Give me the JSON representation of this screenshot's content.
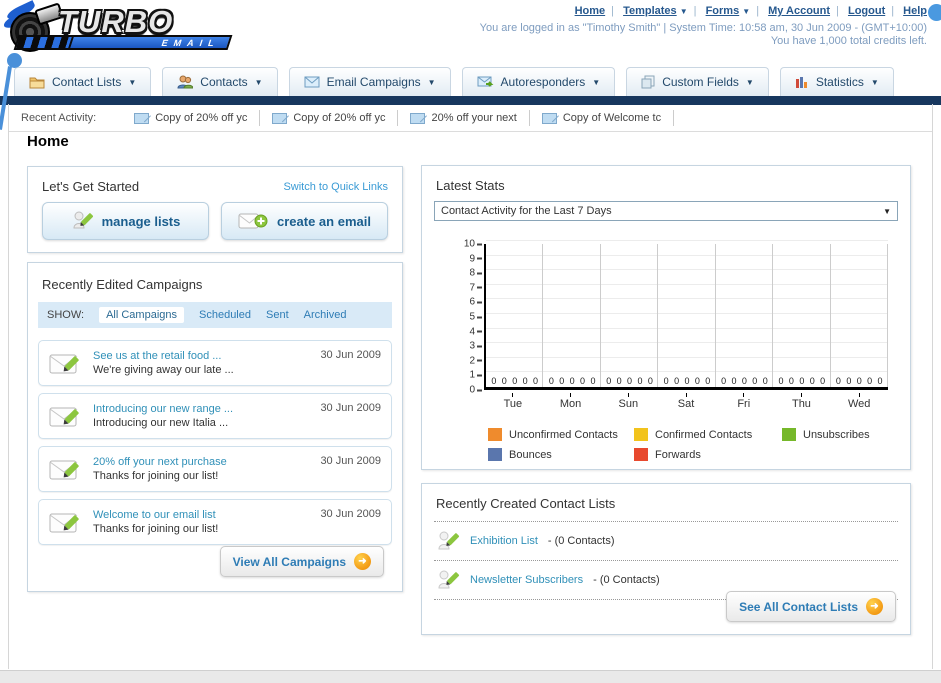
{
  "header": {
    "logo_title": "TURBO",
    "logo_subtitle": "EMAIL",
    "nav_links": [
      {
        "label": "Home",
        "dropdown": false
      },
      {
        "label": "Templates",
        "dropdown": true
      },
      {
        "label": "Forms",
        "dropdown": true
      },
      {
        "label": "My Account",
        "dropdown": false
      },
      {
        "label": "Logout",
        "dropdown": false
      },
      {
        "label": "Help",
        "dropdown": false
      }
    ],
    "login_info": "You are logged in as \"Timothy Smith\" | System Time: 10:58 am, 30 Jun 2009 - (GMT+10:00)",
    "credits_info": "You have 1,000 total credits left."
  },
  "tabs": [
    {
      "label": "Contact Lists",
      "icon": "folder-icon"
    },
    {
      "label": "Contacts",
      "icon": "contacts-icon"
    },
    {
      "label": "Email Campaigns",
      "icon": "envelope-icon"
    },
    {
      "label": "Autoresponders",
      "icon": "autoresponder-icon"
    },
    {
      "label": "Custom Fields",
      "icon": "pages-icon"
    },
    {
      "label": "Statistics",
      "icon": "bar-chart-icon"
    }
  ],
  "recent_activity": {
    "label": "Recent Activity:",
    "items": [
      "Copy of 20% off yc",
      "Copy of 20% off yc",
      "20% off your next ",
      "Copy of Welcome tc"
    ]
  },
  "page_title": "Home",
  "get_started": {
    "title": "Let's Get Started",
    "switch_link": "Switch to Quick Links",
    "manage_lists_label": "manage lists",
    "create_email_label": "create an email"
  },
  "campaigns": {
    "title": "Recently Edited Campaigns",
    "filter_label": "SHOW:",
    "filters": [
      "All Campaigns",
      "Scheduled",
      "Sent",
      "Archived"
    ],
    "active_filter": "All Campaigns",
    "items": [
      {
        "title": "See us at the retail food ...",
        "subtitle": "We're giving away our late ...",
        "date": "30 Jun 2009"
      },
      {
        "title": "Introducing our new range ...",
        "subtitle": "Introducing our new Italia ...",
        "date": "30 Jun 2009"
      },
      {
        "title": "20% off your next purchase",
        "subtitle": "Thanks for joining our list!",
        "date": "30 Jun 2009"
      },
      {
        "title": "Welcome to our email list",
        "subtitle": "Thanks for joining our list!",
        "date": "30 Jun 2009"
      }
    ],
    "view_all_label": "View All Campaigns"
  },
  "stats": {
    "title": "Latest Stats",
    "selected_option": "Contact Activity for the Last 7 Days"
  },
  "chart_data": {
    "type": "bar",
    "title": "Contact Activity for the Last 7 Days",
    "xlabel": "",
    "ylabel": "",
    "categories": [
      "Tue",
      "Mon",
      "Sun",
      "Sat",
      "Fri",
      "Thu",
      "Wed"
    ],
    "series": [
      {
        "name": "Unconfirmed Contacts",
        "color": "#ef8b2d",
        "values": [
          0,
          0,
          0,
          0,
          0,
          0,
          0
        ]
      },
      {
        "name": "Confirmed Contacts",
        "color": "#f2c31c",
        "values": [
          0,
          0,
          0,
          0,
          0,
          0,
          0
        ]
      },
      {
        "name": "Unsubscribes",
        "color": "#76b82a",
        "values": [
          0,
          0,
          0,
          0,
          0,
          0,
          0
        ]
      },
      {
        "name": "Bounces",
        "color": "#5a76ad",
        "values": [
          0,
          0,
          0,
          0,
          0,
          0,
          0
        ]
      },
      {
        "name": "Forwards",
        "color": "#e8492e",
        "values": [
          0,
          0,
          0,
          0,
          0,
          0,
          0
        ]
      }
    ],
    "ylim": [
      0,
      10
    ],
    "yticks": [
      0,
      1,
      2,
      3,
      4,
      5,
      6,
      7,
      8,
      9,
      10
    ],
    "grid": true,
    "legend_position": "bottom"
  },
  "contact_lists": {
    "title": "Recently Created Contact Lists",
    "items": [
      {
        "name": "Exhibition List",
        "count": "- (0 Contacts)"
      },
      {
        "name": "Newsletter Subscribers",
        "count": "- (0 Contacts)"
      }
    ],
    "see_all_label": "See All Contact Lists"
  }
}
